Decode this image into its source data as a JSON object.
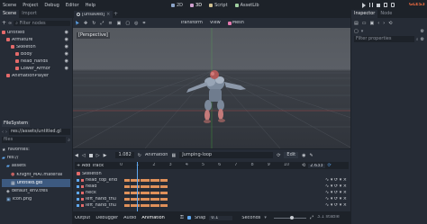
{
  "menu": {
    "items": [
      "Scene",
      "Project",
      "Debug",
      "Editor",
      "Help"
    ],
    "workspaces": [
      "2D",
      "3D",
      "Script",
      "AssetLib"
    ],
    "renderer": "GLES3"
  },
  "colors": {
    "accent": "#5fa8f0",
    "background": "#1d2229",
    "panel": "#262c36",
    "viewport_sky": "#5a5e66",
    "viewport_ground": "#363a42",
    "orange_key": "#e0915a"
  },
  "scene_panel": {
    "tabs": [
      "Scene",
      "Import"
    ],
    "filter_placeholder": "Filter nodes",
    "tree": [
      {
        "label": "untitled",
        "depth": 0,
        "icon": "spatial-icon"
      },
      {
        "label": "Armature",
        "depth": 1,
        "icon": "spatial-icon"
      },
      {
        "label": "Skeleton",
        "depth": 2,
        "icon": "skeleton-icon"
      },
      {
        "label": "Body",
        "depth": 3,
        "icon": "mesh-icon"
      },
      {
        "label": "head_hands",
        "depth": 3,
        "icon": "mesh-icon"
      },
      {
        "label": "Lower_Armor",
        "depth": 3,
        "icon": "mesh-icon"
      },
      {
        "label": "AnimationPlayer",
        "depth": 1,
        "icon": "animation-icon"
      }
    ]
  },
  "filesystem": {
    "title": "FileSystem",
    "path": "res://assets/untitled.gl",
    "search_placeholder": "files",
    "items": [
      {
        "label": "Favorites:",
        "depth": 0,
        "icon": "star-icon",
        "selected": false
      },
      {
        "label": "res://",
        "depth": 0,
        "icon": "folder-icon",
        "selected": false
      },
      {
        "label": "assets",
        "depth": 1,
        "icon": "folder-icon",
        "selected": false
      },
      {
        "label": "Knight_MAT.material",
        "depth": 2,
        "icon": "material-icon",
        "selected": false
      },
      {
        "label": "untitled.glb",
        "depth": 2,
        "icon": "scene-file-icon",
        "selected": true
      },
      {
        "label": "default_env.tres",
        "depth": 1,
        "icon": "resource-icon",
        "selected": false
      },
      {
        "label": "icon.png",
        "depth": 1,
        "icon": "image-icon",
        "selected": false
      }
    ]
  },
  "editor_tabs": {
    "scene_tab": "[unsaved]"
  },
  "viewport_toolbar": {
    "items": [
      "Transform",
      "View",
      "Mesh"
    ],
    "perspective_label": "[Perspective]"
  },
  "animation": {
    "position": "1.082",
    "label": "Animation",
    "current": "Jumping-loop",
    "edit_label": "Edit",
    "add_track": "+ Add Track",
    "ruler": [
      "0",
      "1",
      "2",
      "3",
      "4",
      "5",
      "6",
      "7",
      "8",
      "9",
      "10"
    ],
    "length": "2.633",
    "root_track": "Skeleton",
    "tracks": [
      {
        "name": "head_top_end"
      },
      {
        "name": "head"
      },
      {
        "name": "neck"
      },
      {
        "name": "left_hand_thu"
      },
      {
        "name": "left_hand_thu"
      }
    ],
    "bottom_bar": {
      "output": "Output",
      "debugger": "Debugger",
      "audio": "Audio",
      "animation": "Animation",
      "snap_label": "Snap",
      "snap_value": "0.1",
      "unit": "Seconds",
      "version": "3.1 stable"
    }
  },
  "inspector": {
    "tabs": [
      "Inspector",
      "Node"
    ],
    "filter_placeholder": "Filter properties"
  }
}
